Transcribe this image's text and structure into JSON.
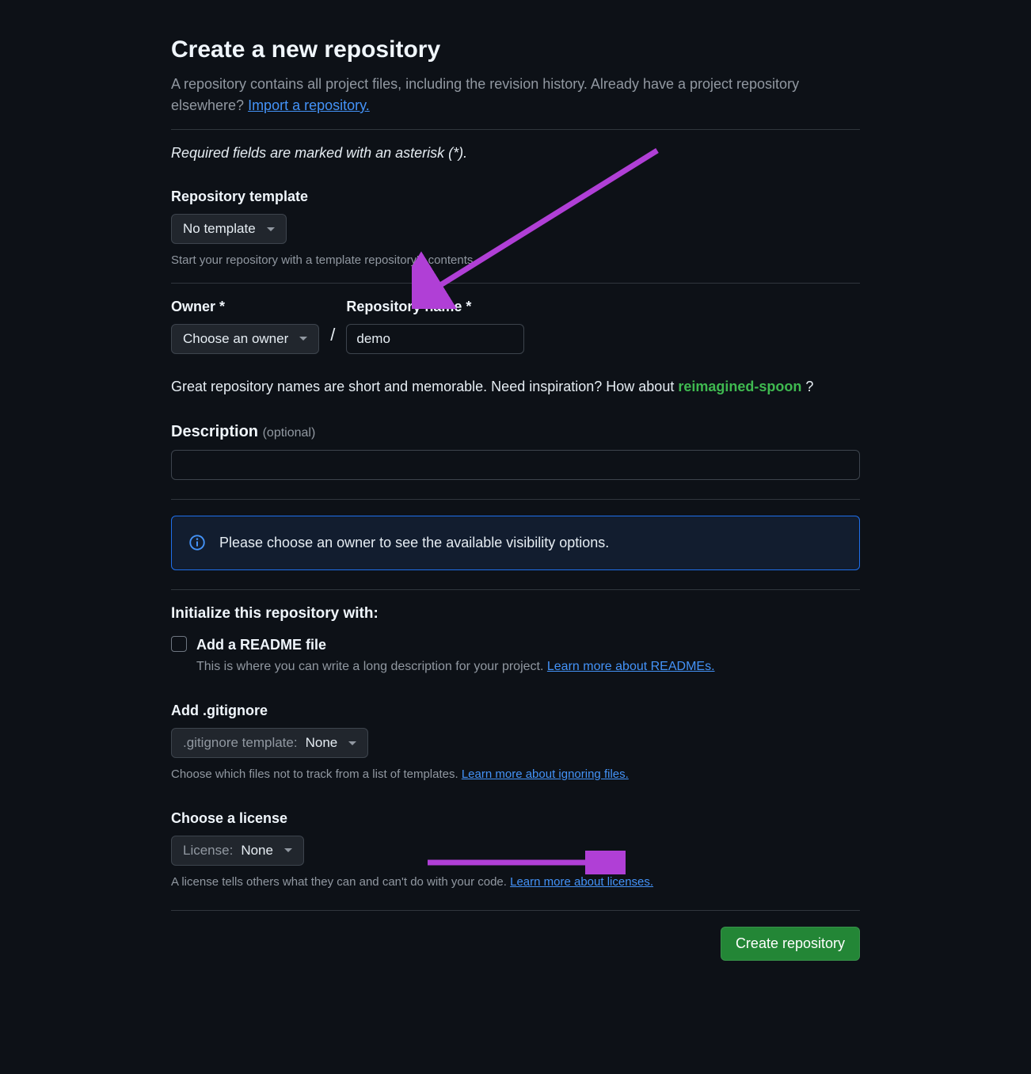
{
  "header": {
    "title": "Create a new repository",
    "subtitle_pre": "A repository contains all project files, including the revision history. Already have a project repository elsewhere? ",
    "import_link": "Import a repository."
  },
  "required_note": "Required fields are marked with an asterisk (*).",
  "template": {
    "label": "Repository template",
    "value": "No template",
    "help": "Start your repository with a template repository's contents."
  },
  "owner": {
    "label": "Owner *",
    "value": "Choose an owner"
  },
  "slash": "/",
  "repo_name": {
    "label": "Repository name *",
    "value": "demo"
  },
  "inspiration": {
    "text_pre": "Great repository names are short and memorable. Need inspiration? How about ",
    "suggestion": "reimagined-spoon",
    "text_post": " ?"
  },
  "description": {
    "label": "Description",
    "optional": "(optional)",
    "value": ""
  },
  "info_box": {
    "text": "Please choose an owner to see the available visibility options."
  },
  "initialize": {
    "heading": "Initialize this repository with:",
    "readme_label": "Add a README file",
    "readme_desc_pre": "This is where you can write a long description for your project. ",
    "readme_link": "Learn more about READMEs."
  },
  "gitignore": {
    "label": "Add .gitignore",
    "prefix": ".gitignore template:",
    "value": "None",
    "help_pre": "Choose which files not to track from a list of templates. ",
    "help_link": "Learn more about ignoring files."
  },
  "license": {
    "label": "Choose a license",
    "prefix": "License:",
    "value": "None",
    "help_pre": "A license tells others what they can and can't do with your code. ",
    "help_link": "Learn more about licenses."
  },
  "actions": {
    "create": "Create repository"
  }
}
